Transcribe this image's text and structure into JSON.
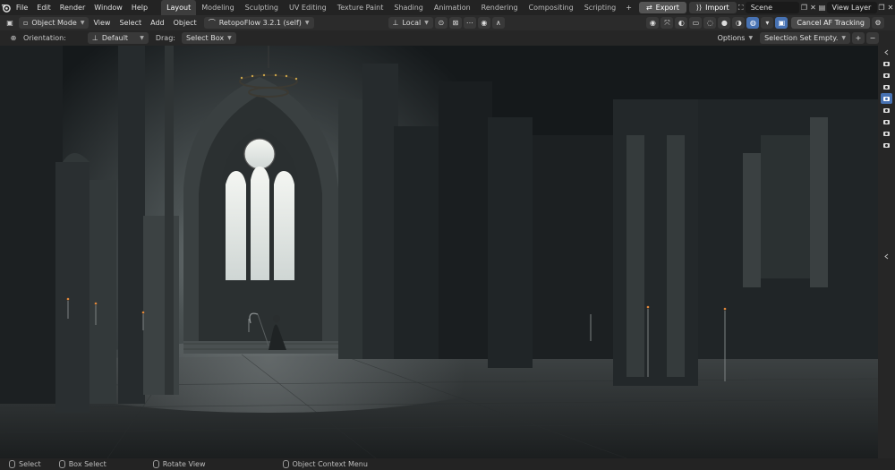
{
  "menu": [
    "File",
    "Edit",
    "Render",
    "Window",
    "Help"
  ],
  "workspaces": [
    "Layout",
    "Modeling",
    "Sculpting",
    "UV Editing",
    "Texture Paint",
    "Shading",
    "Animation",
    "Rendering",
    "Compositing",
    "Scripting"
  ],
  "active_workspace": "Layout",
  "add_workspace": "+",
  "export_label": "Export",
  "import_label": "Import",
  "scene_name": "Scene",
  "view_layer_name": "View Layer",
  "header": {
    "mode": "Object Mode",
    "view": "View",
    "select": "Select",
    "add": "Add",
    "object": "Object",
    "addon": "RetopoFlow 3.2.1 (self)",
    "transform_orientation": "Local",
    "cancel_af": "Cancel AF Tracking"
  },
  "tool_settings": {
    "orientation_label": "Orientation:",
    "orientation_value": "Default",
    "drag_label": "Drag:",
    "drag_value": "Select Box",
    "options": "Options",
    "selection_set": "Selection Set Empty.",
    "plus": "+",
    "minus": "−"
  },
  "status": {
    "select": "Select",
    "box_select": "Box Select",
    "rotate_view": "Rotate View",
    "context_menu": "Object Context Menu"
  },
  "colors": {
    "accent": "#4772b3",
    "topbar": "#232323",
    "header": "#2b2b2b"
  }
}
